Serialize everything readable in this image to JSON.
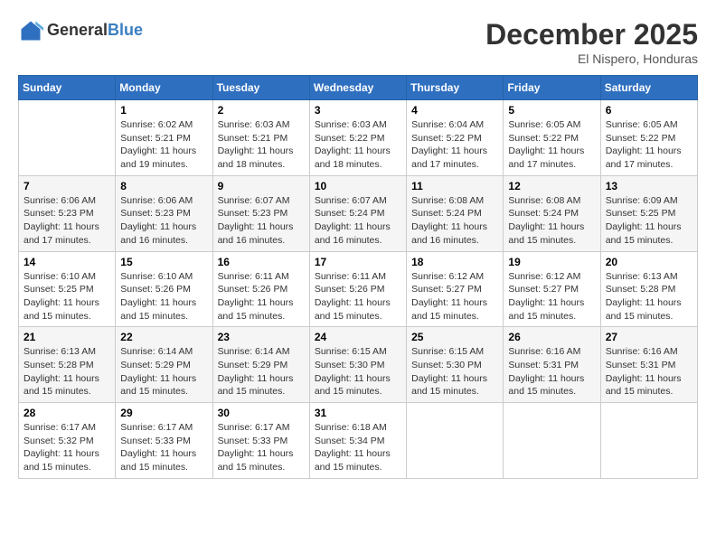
{
  "logo": {
    "general": "General",
    "blue": "Blue"
  },
  "title": "December 2025",
  "location": "El Nispero, Honduras",
  "calendar": {
    "headers": [
      "Sunday",
      "Monday",
      "Tuesday",
      "Wednesday",
      "Thursday",
      "Friday",
      "Saturday"
    ],
    "rows": [
      [
        {
          "day": "",
          "info": ""
        },
        {
          "day": "1",
          "info": "Sunrise: 6:02 AM\nSunset: 5:21 PM\nDaylight: 11 hours\nand 19 minutes."
        },
        {
          "day": "2",
          "info": "Sunrise: 6:03 AM\nSunset: 5:21 PM\nDaylight: 11 hours\nand 18 minutes."
        },
        {
          "day": "3",
          "info": "Sunrise: 6:03 AM\nSunset: 5:22 PM\nDaylight: 11 hours\nand 18 minutes."
        },
        {
          "day": "4",
          "info": "Sunrise: 6:04 AM\nSunset: 5:22 PM\nDaylight: 11 hours\nand 17 minutes."
        },
        {
          "day": "5",
          "info": "Sunrise: 6:05 AM\nSunset: 5:22 PM\nDaylight: 11 hours\nand 17 minutes."
        },
        {
          "day": "6",
          "info": "Sunrise: 6:05 AM\nSunset: 5:22 PM\nDaylight: 11 hours\nand 17 minutes."
        }
      ],
      [
        {
          "day": "7",
          "info": "Sunrise: 6:06 AM\nSunset: 5:23 PM\nDaylight: 11 hours\nand 17 minutes."
        },
        {
          "day": "8",
          "info": "Sunrise: 6:06 AM\nSunset: 5:23 PM\nDaylight: 11 hours\nand 16 minutes."
        },
        {
          "day": "9",
          "info": "Sunrise: 6:07 AM\nSunset: 5:23 PM\nDaylight: 11 hours\nand 16 minutes."
        },
        {
          "day": "10",
          "info": "Sunrise: 6:07 AM\nSunset: 5:24 PM\nDaylight: 11 hours\nand 16 minutes."
        },
        {
          "day": "11",
          "info": "Sunrise: 6:08 AM\nSunset: 5:24 PM\nDaylight: 11 hours\nand 16 minutes."
        },
        {
          "day": "12",
          "info": "Sunrise: 6:08 AM\nSunset: 5:24 PM\nDaylight: 11 hours\nand 15 minutes."
        },
        {
          "day": "13",
          "info": "Sunrise: 6:09 AM\nSunset: 5:25 PM\nDaylight: 11 hours\nand 15 minutes."
        }
      ],
      [
        {
          "day": "14",
          "info": "Sunrise: 6:10 AM\nSunset: 5:25 PM\nDaylight: 11 hours\nand 15 minutes."
        },
        {
          "day": "15",
          "info": "Sunrise: 6:10 AM\nSunset: 5:26 PM\nDaylight: 11 hours\nand 15 minutes."
        },
        {
          "day": "16",
          "info": "Sunrise: 6:11 AM\nSunset: 5:26 PM\nDaylight: 11 hours\nand 15 minutes."
        },
        {
          "day": "17",
          "info": "Sunrise: 6:11 AM\nSunset: 5:26 PM\nDaylight: 11 hours\nand 15 minutes."
        },
        {
          "day": "18",
          "info": "Sunrise: 6:12 AM\nSunset: 5:27 PM\nDaylight: 11 hours\nand 15 minutes."
        },
        {
          "day": "19",
          "info": "Sunrise: 6:12 AM\nSunset: 5:27 PM\nDaylight: 11 hours\nand 15 minutes."
        },
        {
          "day": "20",
          "info": "Sunrise: 6:13 AM\nSunset: 5:28 PM\nDaylight: 11 hours\nand 15 minutes."
        }
      ],
      [
        {
          "day": "21",
          "info": "Sunrise: 6:13 AM\nSunset: 5:28 PM\nDaylight: 11 hours\nand 15 minutes."
        },
        {
          "day": "22",
          "info": "Sunrise: 6:14 AM\nSunset: 5:29 PM\nDaylight: 11 hours\nand 15 minutes."
        },
        {
          "day": "23",
          "info": "Sunrise: 6:14 AM\nSunset: 5:29 PM\nDaylight: 11 hours\nand 15 minutes."
        },
        {
          "day": "24",
          "info": "Sunrise: 6:15 AM\nSunset: 5:30 PM\nDaylight: 11 hours\nand 15 minutes."
        },
        {
          "day": "25",
          "info": "Sunrise: 6:15 AM\nSunset: 5:30 PM\nDaylight: 11 hours\nand 15 minutes."
        },
        {
          "day": "26",
          "info": "Sunrise: 6:16 AM\nSunset: 5:31 PM\nDaylight: 11 hours\nand 15 minutes."
        },
        {
          "day": "27",
          "info": "Sunrise: 6:16 AM\nSunset: 5:31 PM\nDaylight: 11 hours\nand 15 minutes."
        }
      ],
      [
        {
          "day": "28",
          "info": "Sunrise: 6:17 AM\nSunset: 5:32 PM\nDaylight: 11 hours\nand 15 minutes."
        },
        {
          "day": "29",
          "info": "Sunrise: 6:17 AM\nSunset: 5:33 PM\nDaylight: 11 hours\nand 15 minutes."
        },
        {
          "day": "30",
          "info": "Sunrise: 6:17 AM\nSunset: 5:33 PM\nDaylight: 11 hours\nand 15 minutes."
        },
        {
          "day": "31",
          "info": "Sunrise: 6:18 AM\nSunset: 5:34 PM\nDaylight: 11 hours\nand 15 minutes."
        },
        {
          "day": "",
          "info": ""
        },
        {
          "day": "",
          "info": ""
        },
        {
          "day": "",
          "info": ""
        }
      ]
    ]
  }
}
